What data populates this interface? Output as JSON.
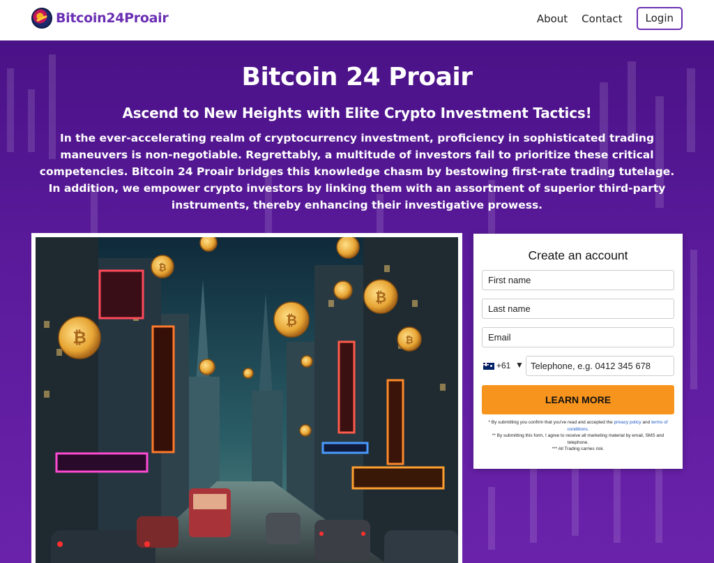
{
  "header": {
    "logo_text": "Bitcoin24Proair",
    "nav": {
      "about": "About",
      "contact": "Contact",
      "login": "Login"
    }
  },
  "hero": {
    "title": "Bitcoin 24 Proair",
    "subtitle": "Ascend to New Heights with Elite Crypto Investment Tactics!",
    "text": "In the ever-accelerating realm of cryptocurrency investment, proficiency in sophisticated trading maneuvers is non-negotiable. Regrettably, a multitude of investors fail to prioritize these critical competencies. Bitcoin 24 Proair bridges this knowledge chasm by bestowing first-rate trading tutelage. In addition, we empower crypto investors by linking them with an assortment of superior third-party instruments, thereby enhancing their investigative prowess."
  },
  "form": {
    "title": "Create an account",
    "first_name": "First name",
    "last_name": "Last name",
    "email": "Email",
    "country_code": "+61",
    "caret": "▼",
    "phone_placeholder": "Telephone, e.g.  0412 345 678",
    "cta": "LEARN MORE",
    "disclaimer": {
      "line1_prefix": "* By submitting you confirm that you've read and accepted the",
      "privacy_link": "privacy policy",
      "and": "and",
      "terms_link": "terms of conditions.",
      "line2": "** By submitting this form, I agree to receive all marketing material by email, SMS and telephone.",
      "line3": "*** All Trading carries risk."
    }
  },
  "colors": {
    "brand": "#6a2fb3",
    "hero_bg": "#5a1a9a",
    "cta": "#f7941d"
  }
}
